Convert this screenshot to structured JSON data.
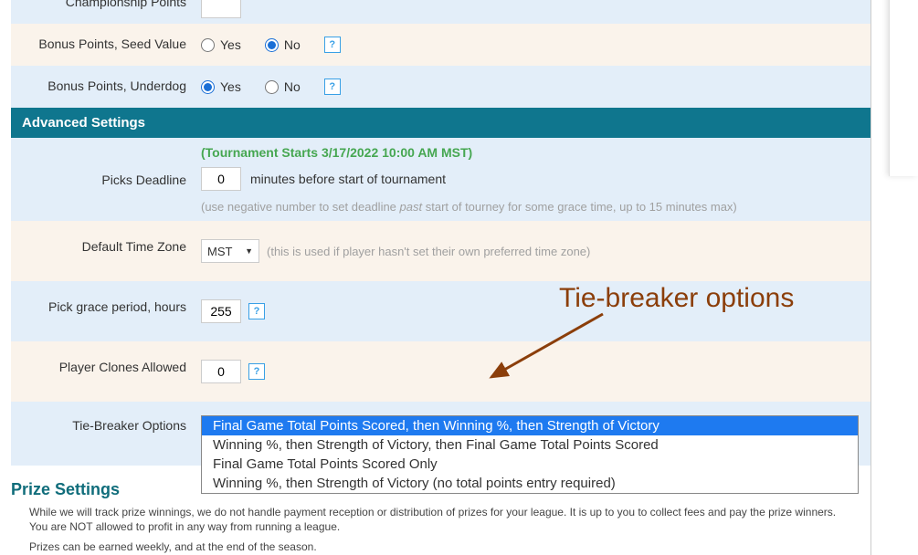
{
  "rows": {
    "championship": {
      "label": "Championship Points",
      "value": ""
    },
    "seed": {
      "label": "Bonus Points, Seed Value",
      "yes": "Yes",
      "no": "No"
    },
    "underdog": {
      "label": "Bonus Points, Underdog",
      "yes": "Yes",
      "no": "No"
    }
  },
  "advanced_header": "Advanced Settings",
  "picks": {
    "label": "Picks Deadline",
    "start_note": "(Tournament Starts 3/17/2022 10:00 AM MST)",
    "value": "0",
    "after_text": "minutes before start of tournament",
    "hint_pre": "(use negative number to set deadline ",
    "hint_em": "past",
    "hint_post": " start of tourney for some grace time, up to 15 minutes max)"
  },
  "tz": {
    "label": "Default Time Zone",
    "value": "MST",
    "hint": "(this is used if player hasn't set their own preferred time zone)"
  },
  "grace": {
    "label": "Pick grace period, hours",
    "value": "255"
  },
  "clones": {
    "label": "Player Clones Allowed",
    "value": "0"
  },
  "tiebreak": {
    "label": "Tie-Breaker Options",
    "selected": "Final Game Total Points Scored, then Winning %, then Strength of Victory",
    "options": [
      "Final Game Total Points Scored, then Winning %, then Strength of Victory",
      "Winning %, then Strength of Victory, then Final Game Total Points Scored",
      "Final Game Total Points Scored Only",
      "Winning %, then Strength of Victory (no total points entry required)"
    ]
  },
  "prize": {
    "heading": "Prize Settings",
    "p1": "While we will track prize winnings, we do not handle payment reception or distribution of prizes for your league. It is up to you to collect fees and pay the prize winners. You are NOT allowed to profit in any way from running a league.",
    "p2": "Prizes can be earned weekly, and at the end of the season."
  },
  "annotation": "Tie-breaker options",
  "help_glyph": "?"
}
